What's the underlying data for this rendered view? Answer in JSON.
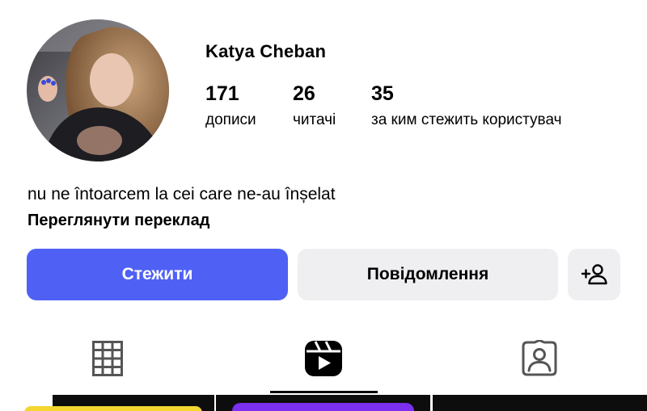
{
  "profile": {
    "username": "Katya Cheban",
    "avatar_icon": "profile-photo"
  },
  "stats": {
    "posts": {
      "value": "171",
      "label": "дописи"
    },
    "followers": {
      "value": "26",
      "label": "читачі"
    },
    "following": {
      "value": "35",
      "label": "за ким стежить користувач"
    }
  },
  "bio": {
    "text": "nu ne întoarcem la cei care ne-au înșelat",
    "translate_label": "Переглянути переклад"
  },
  "actions": {
    "follow_label": "Стежити",
    "message_label": "Повідомлення",
    "add_user_icon": "add-user-icon",
    "follow_color": "#4f61f5",
    "secondary_color": "#efeff2"
  },
  "tabs": {
    "items": [
      {
        "icon": "grid-icon",
        "active": false
      },
      {
        "icon": "reels-icon",
        "active": true
      },
      {
        "icon": "tagged-icon",
        "active": false
      }
    ]
  }
}
